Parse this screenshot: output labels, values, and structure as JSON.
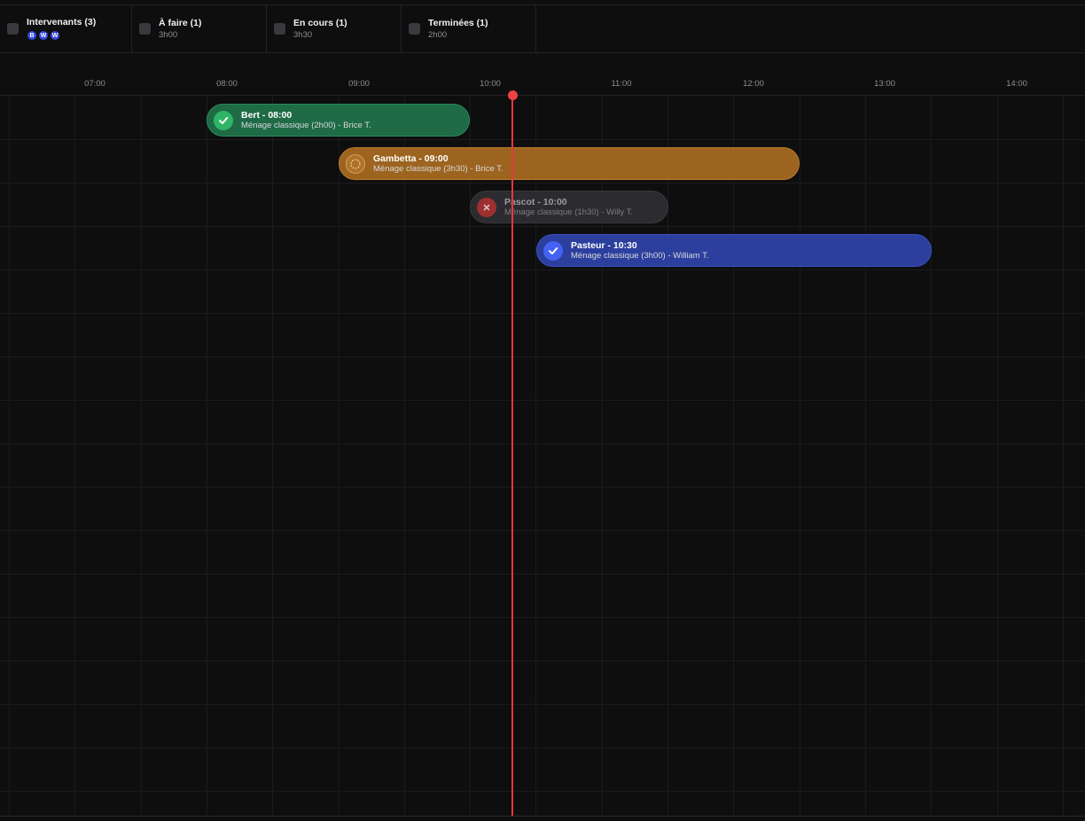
{
  "filters": [
    {
      "label": "Intervenants (3)",
      "avatars": [
        "B",
        "W",
        "W"
      ]
    },
    {
      "label": "À faire (1)",
      "sub": "3h00"
    },
    {
      "label": "En cours (1)",
      "sub": "3h30"
    },
    {
      "label": "Terminées (1)",
      "sub": "2h00"
    }
  ],
  "timeline": {
    "hours": [
      "07:00",
      "08:00",
      "09:00",
      "10:00",
      "11:00",
      "12:00",
      "13:00",
      "14:00"
    ],
    "now": "10:10",
    "tasks": [
      {
        "title": "Bert - 08:00",
        "sub": "Ménage classique (2h00) - Brice T.",
        "status": "done",
        "color": "#1e6b45"
      },
      {
        "title": "Gambetta - 09:00",
        "sub": "Ménage classique (3h30) - Brice T.",
        "status": "in-progress",
        "color": "#9c641f"
      },
      {
        "title": "Pascot - 10:00",
        "sub": "Ménage classique (1h30) - Willy T.",
        "status": "cancelled",
        "color": "#2c2c30"
      },
      {
        "title": "Pasteur - 10:30",
        "sub": "Ménage classique (3h00) - William T.",
        "status": "todo",
        "color": "#2c3f9e"
      }
    ]
  }
}
